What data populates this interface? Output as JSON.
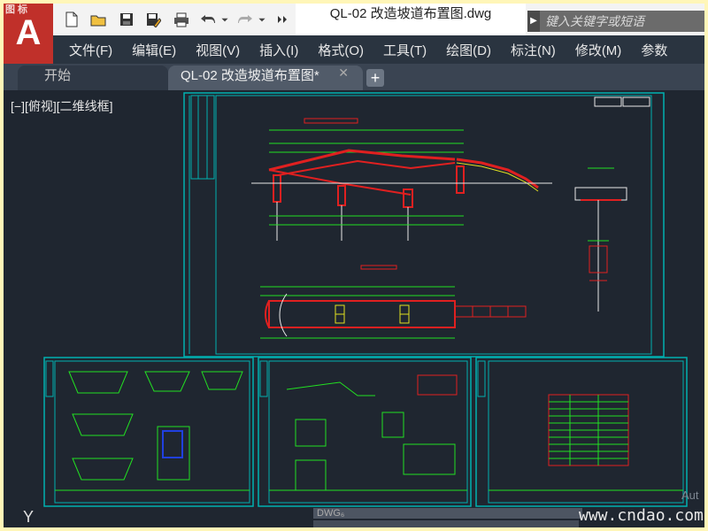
{
  "app": {
    "logo_letter": "A",
    "logo_corner_text": "图 标"
  },
  "quick_access": [
    {
      "name": "new-icon"
    },
    {
      "name": "open-icon"
    },
    {
      "name": "save-icon"
    },
    {
      "name": "save-as-icon"
    },
    {
      "name": "print-icon"
    },
    {
      "name": "undo-icon"
    },
    {
      "name": "redo-icon"
    },
    {
      "name": "more-icon"
    }
  ],
  "window": {
    "title": "QL-02 改造坡道布置图.dwg"
  },
  "search": {
    "placeholder": "键入关键字或短语",
    "arrow": "▶"
  },
  "menu": {
    "items": [
      {
        "id": "file",
        "label": "文件(F)"
      },
      {
        "id": "edit",
        "label": "编辑(E)"
      },
      {
        "id": "view",
        "label": "视图(V)"
      },
      {
        "id": "insert",
        "label": "插入(I)"
      },
      {
        "id": "format",
        "label": "格式(O)"
      },
      {
        "id": "tools",
        "label": "工具(T)"
      },
      {
        "id": "draw",
        "label": "绘图(D)"
      },
      {
        "id": "dimension",
        "label": "标注(N)"
      },
      {
        "id": "modify",
        "label": "修改(M)"
      },
      {
        "id": "params",
        "label": "参数"
      }
    ]
  },
  "tabs": {
    "start": "开始",
    "drawing": "QL-02 改造坡道布置图*",
    "close": "✕",
    "add": "+"
  },
  "viewport": {
    "label": "[−][俯视][二维线框]",
    "ucs_axis": "Y",
    "status_text": "DWG₆",
    "aut_text": "Aut",
    "watermark": "www.cndao.com"
  },
  "colors": {
    "sheet_border": "#00b0b0",
    "green": "#22e022",
    "red": "#e02020",
    "white": "#e8e8e8",
    "yellow": "#e0e020"
  }
}
